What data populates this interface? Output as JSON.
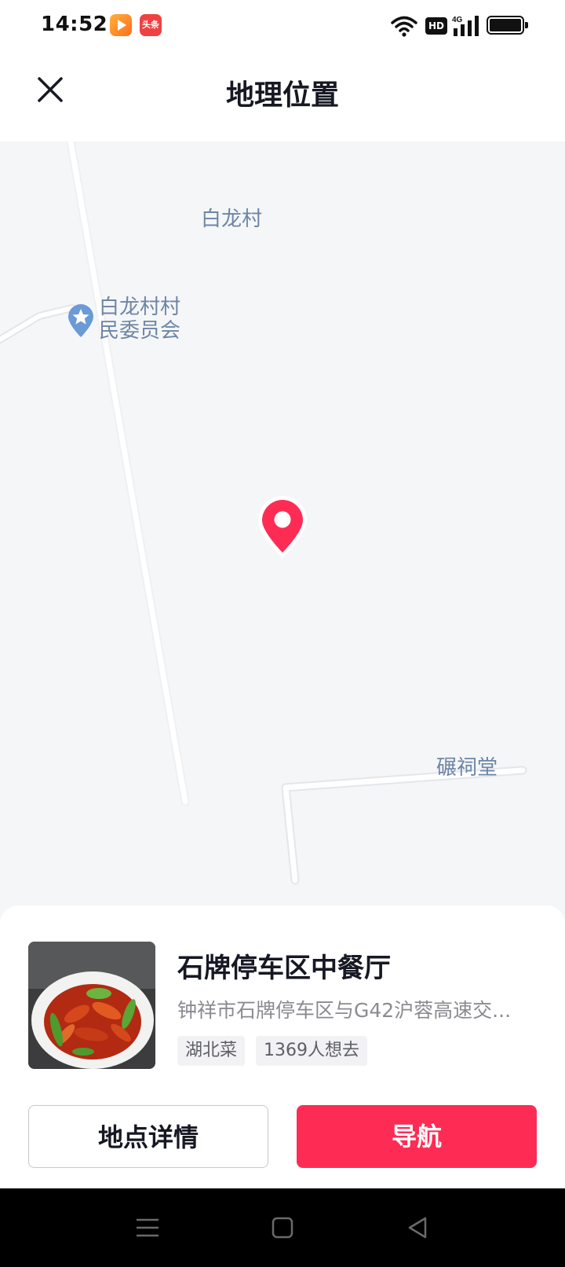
{
  "status_bar": {
    "time": "14:52",
    "app_icons": [
      "video-app-icon",
      "news-app-icon"
    ],
    "news_app_label": "头条",
    "hd_label": "HD",
    "network_label": "4G",
    "icons": [
      "wifi-icon",
      "hd-icon",
      "signal-icon",
      "battery-icon"
    ]
  },
  "header": {
    "title": "地理位置",
    "close_icon": "close-icon"
  },
  "map": {
    "labels": {
      "village": "白龙村",
      "committee_line1": "白龙村村",
      "committee_line2": "民委员会",
      "hall": "碾祠堂"
    },
    "pin_color": "#fe2c55",
    "poi_icon": "star-poi-icon"
  },
  "place": {
    "name": "石牌停车区中餐厅",
    "address": "钟祥市石牌停车区与G42沪蓉高速交...",
    "tags": [
      "湖北菜",
      "1369人想去"
    ],
    "thumbnail": "crayfish-dish-photo"
  },
  "actions": {
    "detail_label": "地点详情",
    "navigate_label": "导航",
    "accent_color": "#fe2c55"
  },
  "system_nav": {
    "icons": [
      "menu-icon",
      "home-icon",
      "back-icon"
    ]
  }
}
